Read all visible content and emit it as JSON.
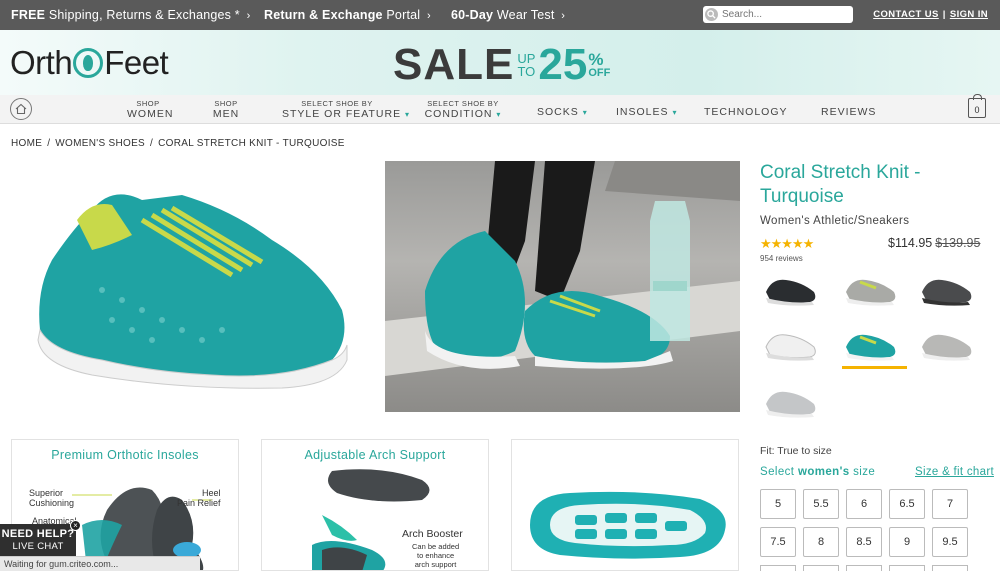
{
  "topbar": {
    "promo1_bold": "FREE",
    "promo1_rest": "Shipping, Returns & Exchanges *",
    "promo2_bold": "Return & Exchange",
    "promo2_rest": "Portal",
    "promo3_bold": "60-Day",
    "promo3_rest": "Wear Test",
    "search_placeholder": "Search...",
    "contact": "CONTACT US",
    "signin": "SIGN IN"
  },
  "banner": {
    "logo_left": "Orth",
    "logo_right": "Feet",
    "sale_word": "SALE",
    "up": "UP",
    "to": "TO",
    "percent_number": "25",
    "percent_sign": "%",
    "off": "OFF"
  },
  "nav": {
    "items": [
      {
        "small": "SHOP",
        "label": "WOMEN"
      },
      {
        "small": "SHOP",
        "label": "MEN"
      },
      {
        "small": "SELECT SHOE BY",
        "label": "STYLE OR FEATURE"
      },
      {
        "small": "SELECT SHOE BY",
        "label": "CONDITION"
      },
      {
        "small": "",
        "label": "SOCKS"
      },
      {
        "small": "",
        "label": "INSOLES"
      },
      {
        "small": "",
        "label": "TECHNOLOGY"
      },
      {
        "small": "",
        "label": "REVIEWS"
      }
    ],
    "cart_count": "0"
  },
  "breadcrumb": [
    "HOME",
    "WOMEN'S SHOES",
    "CORAL STRETCH KNIT - TURQUOISE"
  ],
  "product": {
    "title": "Coral Stretch Knit - Turquoise",
    "category": "Women's Athletic/Sneakers",
    "stars": "★★★★★",
    "review_count": "954 reviews",
    "price": "$114.95",
    "old_price": "$139.95",
    "fit": "Fit: True to size",
    "select_prefix": "Select",
    "select_bold": "women's",
    "select_suffix": "size",
    "size_chart": "Size & fit chart",
    "sizes": [
      "5",
      "5.5",
      "6",
      "6.5",
      "7",
      "7.5",
      "8",
      "8.5",
      "9",
      "9.5"
    ]
  },
  "cards": {
    "insoles_title": "Premium Orthotic Insoles",
    "label_cushion": "Superior\nCushioning",
    "label_heel": "Heel\nPain Relief",
    "label_anatomical": "Anatomical",
    "arch_title": "Adjustable Arch Support",
    "arch_booster": "Arch Booster",
    "arch_desc": "Can be added\nto enhance\narch support"
  },
  "chat": {
    "line1": "NEED HELP?",
    "line2": "LIVE CHAT"
  },
  "status_bar": "Waiting for gum.criteo.com...",
  "colors": {
    "brand_teal": "#2aa79b",
    "star": "#f5b301",
    "topbar": "#5a5a5a"
  }
}
